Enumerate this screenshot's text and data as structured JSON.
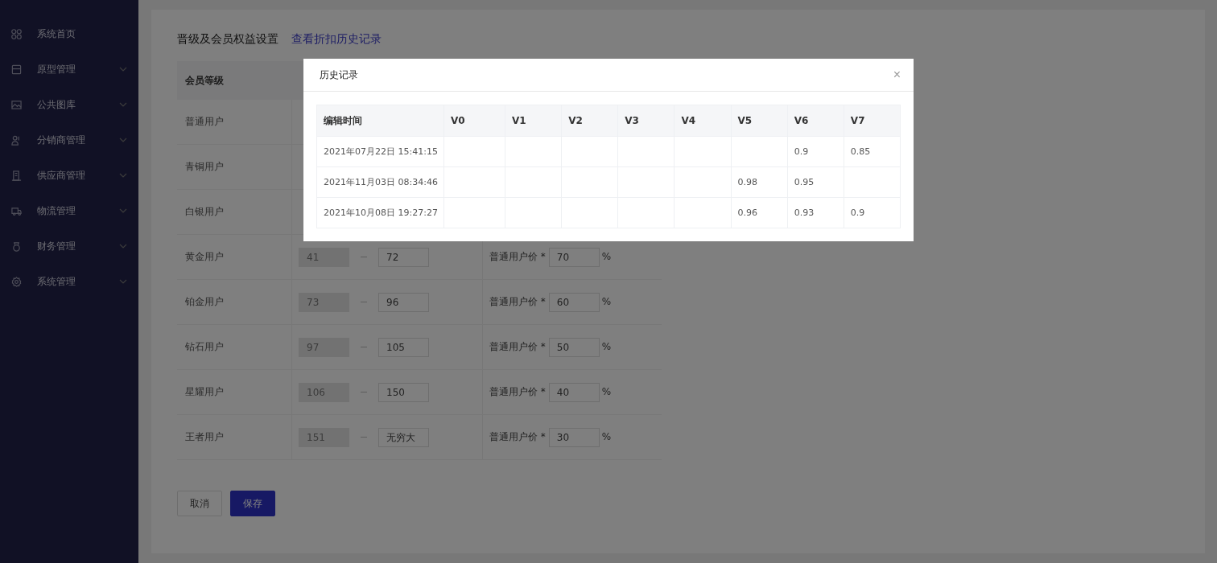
{
  "sidebar": {
    "items": [
      {
        "label": "系统首页",
        "expandable": false
      },
      {
        "label": "原型管理",
        "expandable": true
      },
      {
        "label": "公共图库",
        "expandable": true
      },
      {
        "label": "分销商管理",
        "expandable": true
      },
      {
        "label": "供应商管理",
        "expandable": true
      },
      {
        "label": "物流管理",
        "expandable": true
      },
      {
        "label": "财务管理",
        "expandable": true
      },
      {
        "label": "系统管理",
        "expandable": true
      }
    ]
  },
  "page": {
    "title": "晋级及会员权益设置",
    "link": "查看折扣历史记录",
    "table": {
      "columns": [
        "会员等级"
      ],
      "rows": [
        {
          "level": "普通用户"
        },
        {
          "level": "青铜用户"
        },
        {
          "level": "白银用户"
        },
        {
          "level": "黄金用户",
          "min": {
            "value": "41",
            "disabled": true
          },
          "max": {
            "value": "72",
            "disabled": false
          },
          "discount_label": "普通用户价 *",
          "discount": "70",
          "unit": "%"
        },
        {
          "level": "铂金用户",
          "min": {
            "value": "73",
            "disabled": true
          },
          "max": {
            "value": "96",
            "disabled": false
          },
          "discount_label": "普通用户价 *",
          "discount": "60",
          "unit": "%"
        },
        {
          "level": "钻石用户",
          "min": {
            "value": "97",
            "disabled": true
          },
          "max": {
            "value": "105",
            "disabled": false
          },
          "discount_label": "普通用户价 *",
          "discount": "50",
          "unit": "%"
        },
        {
          "level": "星耀用户",
          "min": {
            "value": "106",
            "disabled": true
          },
          "max": {
            "value": "150",
            "disabled": false
          },
          "discount_label": "普通用户价 *",
          "discount": "40",
          "unit": "%"
        },
        {
          "level": "王者用户",
          "min": {
            "value": "151",
            "disabled": true
          },
          "max": {
            "value": "无穷大",
            "disabled": false
          },
          "discount_label": "普通用户价 *",
          "discount": "30",
          "unit": "%"
        }
      ]
    },
    "buttons": [
      {
        "label": "取消",
        "kind": "default"
      },
      {
        "label": "保存",
        "kind": "primary"
      }
    ]
  },
  "modal": {
    "title": "历史记录",
    "close": "×",
    "columns": [
      "编辑时间",
      "V0",
      "V1",
      "V2",
      "V3",
      "V4",
      "V5",
      "V6",
      "V7"
    ],
    "rows": [
      {
        "cells": [
          "2021年07月22日 15:41:15",
          "",
          "",
          "",
          "",
          "",
          "",
          "0.9",
          "0.85"
        ]
      },
      {
        "cells": [
          "2021年11月03日 08:34:46",
          "",
          "",
          "",
          "",
          "",
          "0.98",
          "0.95",
          ""
        ]
      },
      {
        "cells": [
          "2021年10月08日 19:27:27",
          "",
          "",
          "",
          "",
          "",
          "0.96",
          "0.93",
          "0.9"
        ]
      }
    ]
  }
}
